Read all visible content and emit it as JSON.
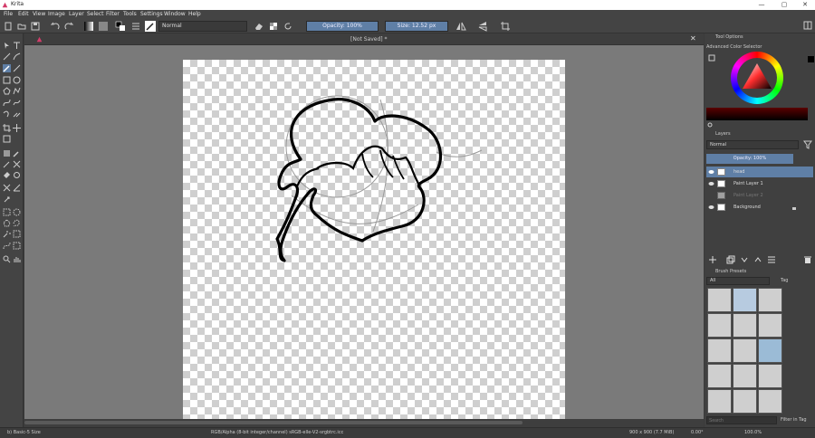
{
  "window": {
    "title": "Krita",
    "min": "—",
    "max": "▢",
    "close": "✕"
  },
  "menu": [
    "File",
    "Edit",
    "View",
    "Image",
    "Layer",
    "Select",
    "Filter",
    "Tools",
    "Settings",
    "Window",
    "Help"
  ],
  "toolbar": {
    "blend_mode": "Normal",
    "opacity": "Opacity: 100%",
    "size": "Size: 12.52 px"
  },
  "document": {
    "tab_title": "[Not Saved] *"
  },
  "dockers": {
    "tool_options": "Tool Options",
    "color_selector": "Advanced Color Selector",
    "layers": {
      "title": "Layers",
      "blend_mode": "Normal",
      "opacity": "Opacity: 100%",
      "items": [
        {
          "name": "head",
          "selected": true
        },
        {
          "name": "Paint Layer 1",
          "selected": false
        },
        {
          "name": "Paint Layer 2",
          "selected": false
        },
        {
          "name": "Background",
          "selected": false
        }
      ]
    },
    "brush_presets": {
      "title": "Brush Presets",
      "filter": "All",
      "tag_label": "Tag",
      "search_placeholder": "Search",
      "filter_in_tag": "Filter in Tag"
    }
  },
  "status": {
    "brush": "b) Basic-5 Size",
    "color_space": "RGB/Alpha (8-bit integer/channel)  sRGB-elle-V2-srgbtrc.icc",
    "image_size": "900 x 900 (7.7 MiB)",
    "rotation": "0.00°",
    "zoom": "100.0%"
  }
}
